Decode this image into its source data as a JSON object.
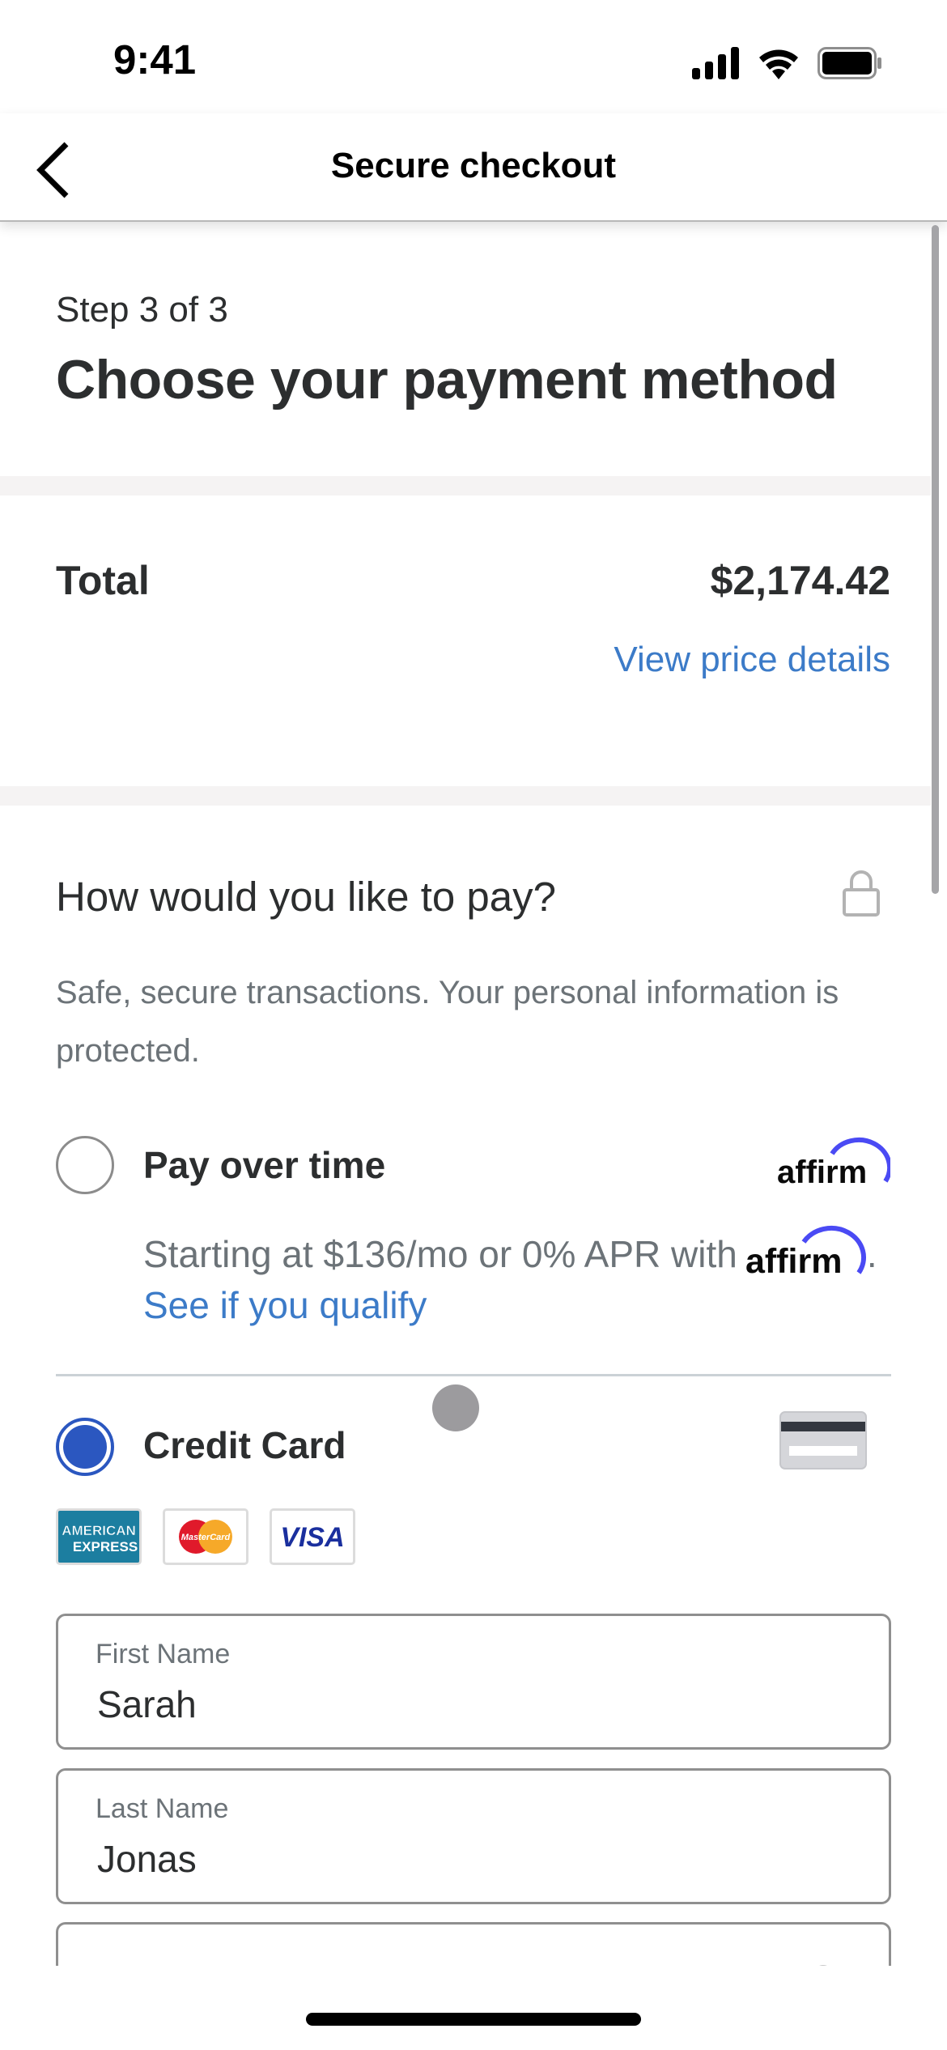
{
  "status_bar": {
    "time": "9:41",
    "icons": [
      "cellular-signal-icon",
      "wifi-icon",
      "battery-icon"
    ]
  },
  "nav": {
    "back_icon": "chevron-left-icon",
    "title": "Secure checkout"
  },
  "header": {
    "step": "Step 3 of 3",
    "title": "Choose your payment method"
  },
  "total": {
    "label": "Total",
    "value": "$2,174.42",
    "details_link": "View price details"
  },
  "payment": {
    "heading": "How would you like to pay?",
    "lock_icon": "lock-icon",
    "note": "Safe, secure transactions. Your personal information is protected.",
    "options": [
      {
        "label": "Pay over time",
        "selected": false,
        "logo": "affirm",
        "description": "Starting at $136/mo or 0% APR with",
        "description_suffix": ".",
        "link": "See if you qualify"
      },
      {
        "label": "Credit Card",
        "selected": true,
        "icon": "credit-card-icon",
        "brands": [
          {
            "name": "American Express",
            "line1": "AMERICAN",
            "line2": "EXPRESS"
          },
          {
            "name": "MasterCard",
            "text": "MasterCard"
          },
          {
            "name": "Visa",
            "text": "VISA"
          }
        ]
      }
    ]
  },
  "form": {
    "first_name": {
      "label": "First Name",
      "value": "Sarah"
    },
    "last_name": {
      "label": "Last Name",
      "value": "Jonas"
    }
  },
  "brand_text": {
    "affirm": "affirm"
  },
  "colors": {
    "accent_blue": "#2b57c0",
    "link_blue": "#3c7bc8",
    "affirm_purple": "#4a4af4",
    "text_dark": "#2c2e2f",
    "text_muted": "#6c7378"
  }
}
